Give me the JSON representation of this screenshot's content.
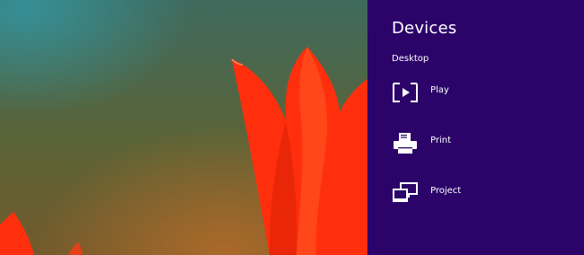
{
  "panel": {
    "title": "Devices",
    "subtitle": "Desktop",
    "items": [
      {
        "label": "Play",
        "icon": "play-to-icon"
      },
      {
        "label": "Print",
        "icon": "printer-icon"
      },
      {
        "label": "Project",
        "icon": "project-screens-icon"
      }
    ]
  },
  "colors": {
    "panel_background": "#2b0369",
    "text": "#ffffff",
    "flower": "#ff2f0d"
  }
}
